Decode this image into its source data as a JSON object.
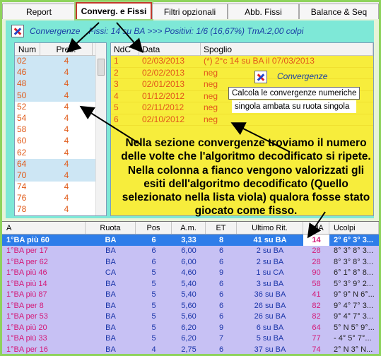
{
  "tabs": [
    "Report",
    "Converg. e Fissi",
    "Filtri opzionali",
    "Abb. Fissi",
    "Balance & Seq"
  ],
  "active_tab": 1,
  "header": {
    "title": "Convergenze",
    "summary": "Fissi: 14 su BA >>> Positivi: 1/6 (16,67%)   TmA:2,00 colpi"
  },
  "left_table": {
    "columns": [
      "Num",
      "Pres."
    ],
    "rows": [
      [
        "02",
        "4"
      ],
      [
        "46",
        "4"
      ],
      [
        "48",
        "4"
      ],
      [
        "50",
        "4"
      ],
      [
        "52",
        "4"
      ],
      [
        "54",
        "4"
      ],
      [
        "58",
        "4"
      ],
      [
        "60",
        "4"
      ],
      [
        "62",
        "4"
      ],
      [
        "64",
        "4"
      ],
      [
        "70",
        "4"
      ],
      [
        "74",
        "4"
      ],
      [
        "76",
        "4"
      ],
      [
        "78",
        "4"
      ]
    ]
  },
  "right_table": {
    "columns": [
      "NdC",
      "Data",
      "Spoglio"
    ],
    "rows": [
      [
        "1",
        "02/03/2013",
        "(*) 2°c 14 su BA il 07/03/2013"
      ],
      [
        "2",
        "02/02/2013",
        "neg"
      ],
      [
        "3",
        "02/01/2013",
        "neg"
      ],
      [
        "4",
        "01/12/2012",
        "neg"
      ],
      [
        "5",
        "02/11/2012",
        "neg"
      ],
      [
        "6",
        "02/10/2012",
        "neg"
      ]
    ]
  },
  "tooltip": {
    "title": "Convergenze",
    "line1": "Calcola le convergenze numeriche",
    "line2": "singola ambata su ruota singola"
  },
  "annotation": "Nella sezione convergenze troviamo il numero delle volte che l'algoritmo decodificato si ripete. Nella colonna a fianco vengono valorizzati gli esiti dell'algoritmo decodificato (Quello selezionato nella lista viola) qualora fosse stato giocato come fisso.",
  "bottom_table": {
    "columns": [
      "A",
      "Ruota",
      "Pos",
      "A.m.",
      "ET",
      "Ultimo Rit.",
      "UdA",
      "Ucolpi"
    ],
    "rows": [
      [
        "1°BA  più 60",
        "BA",
        "6",
        "3,33",
        "8",
        "41 su BA",
        "14",
        "2° 6° 3° 3..."
      ],
      [
        "1°BA  per 17",
        "BA",
        "6",
        "6,00",
        "6",
        "2 su BA",
        "28",
        "8° 3° 8° 3..."
      ],
      [
        "1°BA  per 62",
        "BA",
        "6",
        "6,00",
        "6",
        "2 su BA",
        "28",
        "8° 3° 8° 3..."
      ],
      [
        "1°BA  più 46",
        "CA",
        "5",
        "4,60",
        "9",
        "1 su CA",
        "90",
        "6° 1° 8° 8..."
      ],
      [
        "1°BA  più 14",
        "BA",
        "5",
        "5,40",
        "6",
        "3 su BA",
        "58",
        "5° 3° 9° 2..."
      ],
      [
        "1°BA  più 87",
        "BA",
        "5",
        "5,40",
        "6",
        "36 su BA",
        "41",
        "9° 9° N 6°..."
      ],
      [
        "1°BA  per 8",
        "BA",
        "5",
        "5,60",
        "6",
        "26 su BA",
        "82",
        "9° 4° 7° 3..."
      ],
      [
        "1°BA  per 53",
        "BA",
        "5",
        "5,60",
        "6",
        "26 su BA",
        "82",
        "9° 4° 7° 3..."
      ],
      [
        "1°BA  più 20",
        "BA",
        "5",
        "6,20",
        "9",
        "6 su BA",
        "64",
        "5° N 5° 9°..."
      ],
      [
        "1°BA  più 33",
        "BA",
        "5",
        "6,20",
        "7",
        "5 su BA",
        "77",
        "- 4° 5° 7°..."
      ],
      [
        "1°BA  per 16",
        "BA",
        "4",
        "2,75",
        "6",
        "37 su BA",
        "74",
        "2° N 3° N..."
      ]
    ]
  }
}
